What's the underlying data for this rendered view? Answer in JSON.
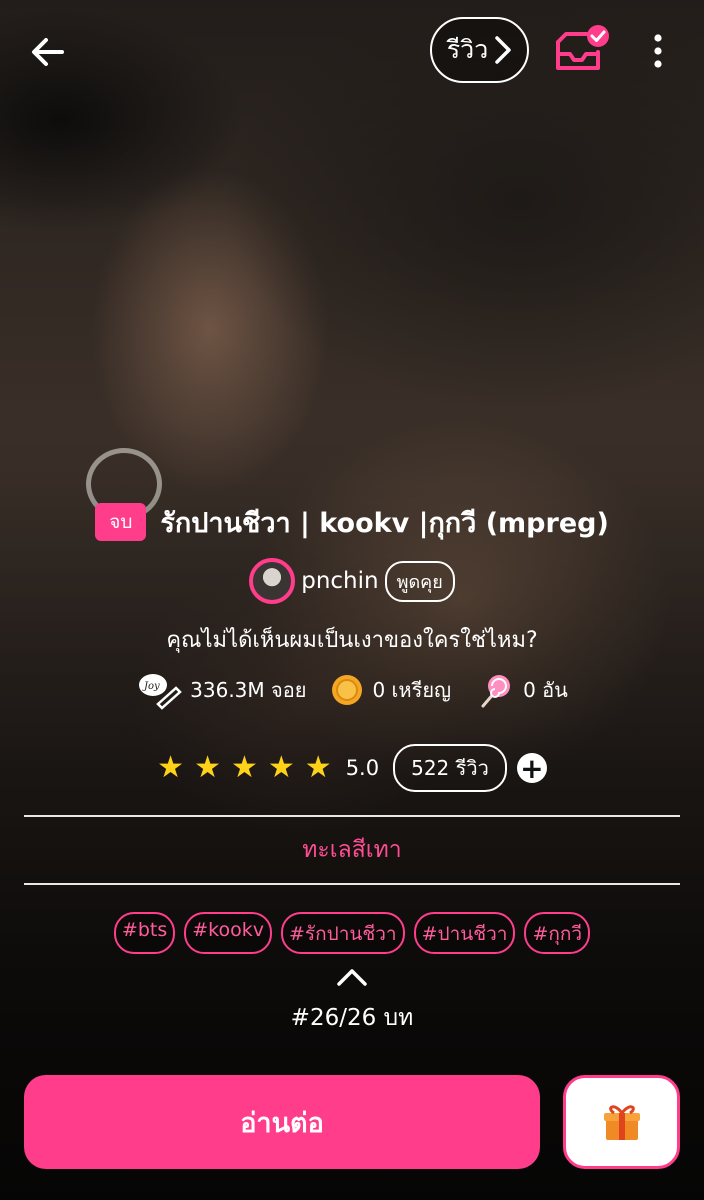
{
  "topbar": {
    "review_label": "รีวิว"
  },
  "story": {
    "status": "จบ",
    "title": "รักปานชีวา | kookv |กุกวี (mpreg)",
    "author": "pnchin",
    "chat_label": "พูดคุย",
    "tagline": "คุณไม่ได้เห็นผมเป็นเงาของใครใช่ไหม?",
    "stats": {
      "joy": "336.3M จอย",
      "coins": "0 เหรียญ",
      "candy": "0 อัน"
    },
    "rating": {
      "stars": 5,
      "value": "5.0",
      "reviews": "522 รีวิว"
    },
    "category": "ทะเลสีเทา",
    "tags": [
      "#bts",
      "#kookv",
      "#รักปานชีวา",
      "#ปานชีวา",
      "#กุกวี"
    ],
    "episode": "#26/26 บท"
  },
  "actions": {
    "continue_label": "อ่านต่อ"
  },
  "colors": {
    "accent": "#ff3d8b",
    "star": "#ffd21a"
  },
  "icons": [
    "back-arrow-icon",
    "chevron-right-icon",
    "library-check-icon",
    "more-vert-icon",
    "joy-pen-icon",
    "coin-icon",
    "lollipop-icon",
    "star-icon",
    "plus-icon",
    "chevron-up-icon",
    "gift-icon"
  ]
}
